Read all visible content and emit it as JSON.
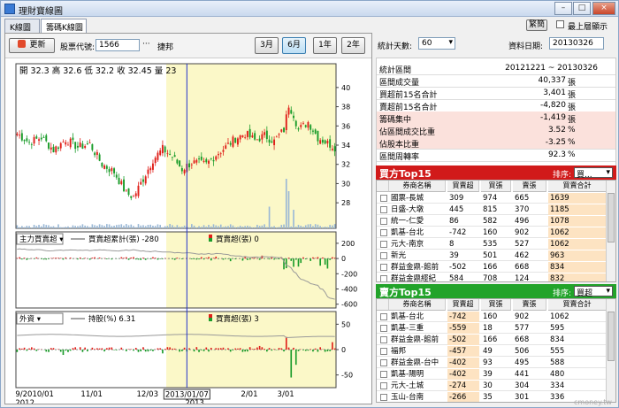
{
  "window": {
    "title": "理財寶線圖",
    "minimize": "–",
    "maximize": "□",
    "close": "×"
  },
  "tabs": [
    "K線圖",
    "籌碼K線圖"
  ],
  "top_right": {
    "title_btn": "繁簡",
    "always_top": "最上層顯示"
  },
  "toolbar": {
    "refresh": "更新",
    "code_label": "股票代號:",
    "code_value": "1566",
    "more": "···",
    "stock_name": "捷邦",
    "ranges": [
      "3月",
      "6月",
      "1年",
      "2年"
    ],
    "selected_range": "6月"
  },
  "stats_bar": {
    "days_label": "統計天數:",
    "days_value": "60",
    "date_label": "資料日期:",
    "date_value": "20130326"
  },
  "stats": [
    {
      "k": "統計區間",
      "v": "20121221 ~ 20130326",
      "u": "",
      "pink": false
    },
    {
      "k": "區間成交量",
      "v": "40,337",
      "u": "張",
      "pink": false
    },
    {
      "k": "買超前15名合計",
      "v": "3,401",
      "u": "張",
      "pink": false
    },
    {
      "k": "賣超前15名合計",
      "v": "-4,820",
      "u": "張",
      "pink": false
    },
    {
      "k": "籌碼集中",
      "v": "-1,419",
      "u": "張",
      "pink": true
    },
    {
      "k": "佔區間成交比重",
      "v": "3.52",
      "u": "%",
      "pink": true
    },
    {
      "k": "佔股本比重",
      "v": "-3.25",
      "u": "%",
      "pink": true
    },
    {
      "k": "區間周轉率",
      "v": "92.3",
      "u": "%",
      "pink": false
    }
  ],
  "buy_top": {
    "title": "買方Top15",
    "sort_label": "排序:",
    "sort_value": "買...",
    "headers": [
      "券商名稱",
      "買賣超",
      "買張",
      "賣張",
      "買賣合計"
    ],
    "rows": [
      [
        "國票-長城",
        "309",
        "974",
        "665",
        "1639"
      ],
      [
        "日盛-大墩",
        "445",
        "815",
        "370",
        "1185"
      ],
      [
        "統一-仁愛",
        "86",
        "582",
        "496",
        "1078"
      ],
      [
        "凱基-台北",
        "-742",
        "160",
        "902",
        "1062"
      ],
      [
        "元大-南京",
        "8",
        "535",
        "527",
        "1062"
      ],
      [
        "新光",
        "39",
        "501",
        "462",
        "963"
      ],
      [
        "群益金鼎-館前",
        "-502",
        "166",
        "668",
        "834"
      ],
      [
        "群益金鼎經紀",
        "584",
        "708",
        "124",
        "832"
      ]
    ]
  },
  "sell_top": {
    "title": "賣方Top15",
    "sort_label": "排序:",
    "sort_value": "買超",
    "headers": [
      "券商名稱",
      "買賣超",
      "買張",
      "賣張",
      "買賣合計"
    ],
    "rows": [
      [
        "凱基-台北",
        "-742",
        "160",
        "902",
        "1062"
      ],
      [
        "凱基-三重",
        "-559",
        "18",
        "577",
        "595"
      ],
      [
        "群益金鼎-館前",
        "-502",
        "166",
        "668",
        "834"
      ],
      [
        "福邦",
        "-457",
        "49",
        "506",
        "555"
      ],
      [
        "群益金鼎-台中",
        "-402",
        "93",
        "495",
        "588"
      ],
      [
        "凱基-陽明",
        "-402",
        "39",
        "441",
        "480"
      ],
      [
        "元大-土城",
        "-274",
        "30",
        "304",
        "334"
      ],
      [
        "玉山-台南",
        "-266",
        "35",
        "301",
        "336"
      ]
    ]
  },
  "watermark": "cmoney.tw",
  "chart_data": {
    "type": "candlestick",
    "info": "開 32.3  高 32.6  低 32.2  收 32.45  量 23",
    "price_axis": [
      40,
      38,
      36,
      34,
      32,
      30,
      28
    ],
    "price_range": [
      27,
      41
    ],
    "x_labels": [
      {
        "text": "9/2010/01",
        "i": 0
      },
      {
        "text": "11/01",
        "i": 27
      },
      {
        "text": "12/03",
        "i": 50
      },
      {
        "text": "2/01",
        "i": 93
      },
      {
        "text": "3/01",
        "i": 108
      }
    ],
    "year_labels": [
      {
        "text": "2012",
        "i": 0
      },
      {
        "text": "2013",
        "i": 70
      }
    ],
    "cursor": {
      "i": 70,
      "label": "2013/01/07"
    },
    "highlight_start": 62,
    "n": 132,
    "anchors_close": [
      [
        0,
        35.2
      ],
      [
        5,
        34.3
      ],
      [
        10,
        34.8
      ],
      [
        15,
        33.5
      ],
      [
        20,
        34.6
      ],
      [
        25,
        33.8
      ],
      [
        30,
        34.1
      ],
      [
        35,
        32.0
      ],
      [
        40,
        31.2
      ],
      [
        45,
        29.0
      ],
      [
        48,
        28.6
      ],
      [
        52,
        30.5
      ],
      [
        56,
        32.5
      ],
      [
        60,
        33.6
      ],
      [
        64,
        32.8
      ],
      [
        68,
        31.5
      ],
      [
        72,
        32.2
      ],
      [
        78,
        32.0
      ],
      [
        82,
        33.0
      ],
      [
        86,
        33.8
      ],
      [
        90,
        34.7
      ],
      [
        94,
        35.2
      ],
      [
        98,
        34.5
      ],
      [
        102,
        35.0
      ],
      [
        106,
        34.4
      ],
      [
        110,
        35.6
      ],
      [
        112,
        38.2
      ],
      [
        114,
        37.2
      ],
      [
        116,
        35.6
      ],
      [
        120,
        36.4
      ],
      [
        124,
        34.8
      ],
      [
        128,
        34.2
      ],
      [
        131,
        33.8
      ]
    ],
    "volume_spikes": [
      [
        111,
        8
      ],
      [
        112,
        6
      ],
      [
        104,
        3.5
      ],
      [
        114,
        3
      ]
    ],
    "panel2": {
      "selector": "主力買賣超",
      "legend1": "買賣超累計(張) -280",
      "legend2": "買賣超(張) 0",
      "axis": [
        200,
        0,
        -200,
        -400,
        -600
      ],
      "range": [
        -650,
        350
      ]
    },
    "panel3": {
      "selector": "外資",
      "legend1": "持股(%) 6.31",
      "legend2": "買賣超(張) 3",
      "axis": [
        50,
        0,
        -50
      ],
      "range": [
        -75,
        75
      ]
    }
  }
}
